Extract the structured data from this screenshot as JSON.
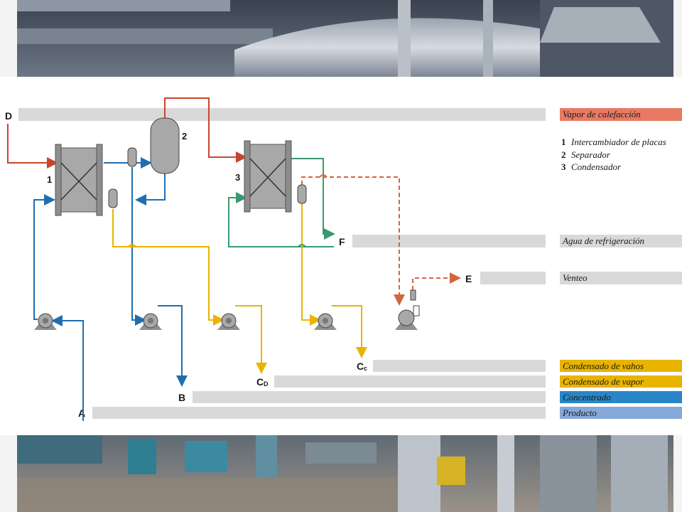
{
  "colors": {
    "heating_steam": "#c8452c",
    "cooling_water": "#3a9a6e",
    "vent": "#d2663c",
    "condensate": "#e8b400",
    "concentrate": "#1f6fb0",
    "product": "#7aa0d4",
    "bar": "#d9d9d9",
    "equipment": "#9a9a9a"
  },
  "equipment_numbers": {
    "plate_exchanger": "1",
    "separator": "2",
    "condenser": "3"
  },
  "stream_letters": {
    "heating_steam": "D",
    "cooling_water": "F",
    "vent": "E",
    "vapor_condensate": "C",
    "vapor_condensate_sub": "c",
    "steam_condensate": "C",
    "steam_condensate_sub": "D",
    "concentrate": "B",
    "product": "A"
  },
  "equipment_legend": [
    {
      "num": "1",
      "label": "Intercambiador de placas"
    },
    {
      "num": "2",
      "label": "Separador"
    },
    {
      "num": "3",
      "label": "Condensador"
    }
  ],
  "stream_legend": {
    "heating_steam": "Vapor de calefacción",
    "cooling_water": "Agua de refrigeración",
    "vent": "Venteo",
    "vapor_condensate": "Condensado de vahos",
    "steam_condensate": "Condensado de vapor",
    "concentrate": "Concentrado",
    "product": "Producto"
  }
}
